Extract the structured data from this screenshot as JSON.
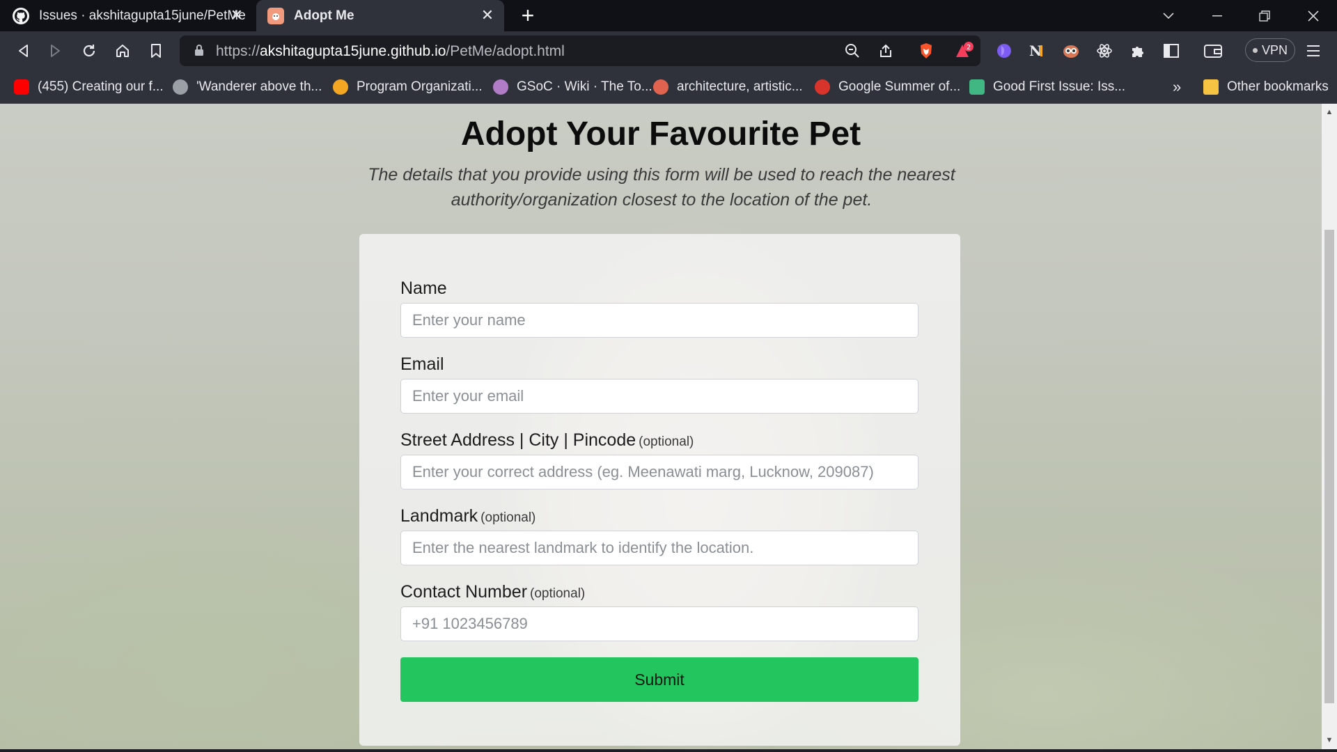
{
  "browser": {
    "tabs": [
      {
        "title": "Issues · akshitagupta15june/PetMe",
        "favicon": "github-icon",
        "active": false
      },
      {
        "title": "Adopt Me",
        "favicon": "adopt-me-icon",
        "active": true
      }
    ],
    "url": {
      "scheme": "https://",
      "domain": "akshitagupta15june.github.io",
      "path": "/PetMe/adopt.html"
    },
    "brave_rewards_badge": "2",
    "vpn_label": "VPN",
    "bookmarks": [
      {
        "label": "(455) Creating our f...",
        "icon": "youtube-icon",
        "color": "#ff0000"
      },
      {
        "label": "'Wanderer above th...",
        "icon": "globe-icon",
        "color": "#9aa0a6"
      },
      {
        "label": "Program Organizati...",
        "icon": "gear-badge-icon",
        "color": "#f5a623"
      },
      {
        "label": "GSoC · Wiki · The To...",
        "icon": "onion-icon",
        "color": "#b07cc6"
      },
      {
        "label": "architecture, artistic...",
        "icon": "flame-icon",
        "color": "#e0634f"
      },
      {
        "label": "Google Summer of...",
        "icon": "gsoc-icon",
        "color": "#d9342b"
      },
      {
        "label": "Good First Issue: Iss...",
        "icon": "gfi-icon",
        "color": "#41b883"
      }
    ],
    "overflow_label": "»",
    "other_bookmarks": "Other bookmarks"
  },
  "page": {
    "title": "Adopt Your Favourite Pet",
    "subtitle": "The details that you provide using this form will be used to reach the nearest authority/organization closest to the location of the pet.",
    "form": {
      "name": {
        "label": "Name",
        "placeholder": "Enter your name"
      },
      "email": {
        "label": "Email",
        "placeholder": "Enter your email"
      },
      "address": {
        "label": "Street Address | City | Pincode",
        "optional": "(optional)",
        "placeholder": "Enter your correct address (eg. Meenawati marg, Lucknow, 209087)"
      },
      "landmark": {
        "label": "Landmark",
        "optional": "(optional)",
        "placeholder": "Enter the nearest landmark to identify the location."
      },
      "contact": {
        "label": "Contact Number",
        "optional": "(optional)",
        "placeholder": "+91 1023456789"
      },
      "submit_label": "Submit",
      "submit_color": "#22c55e"
    }
  }
}
